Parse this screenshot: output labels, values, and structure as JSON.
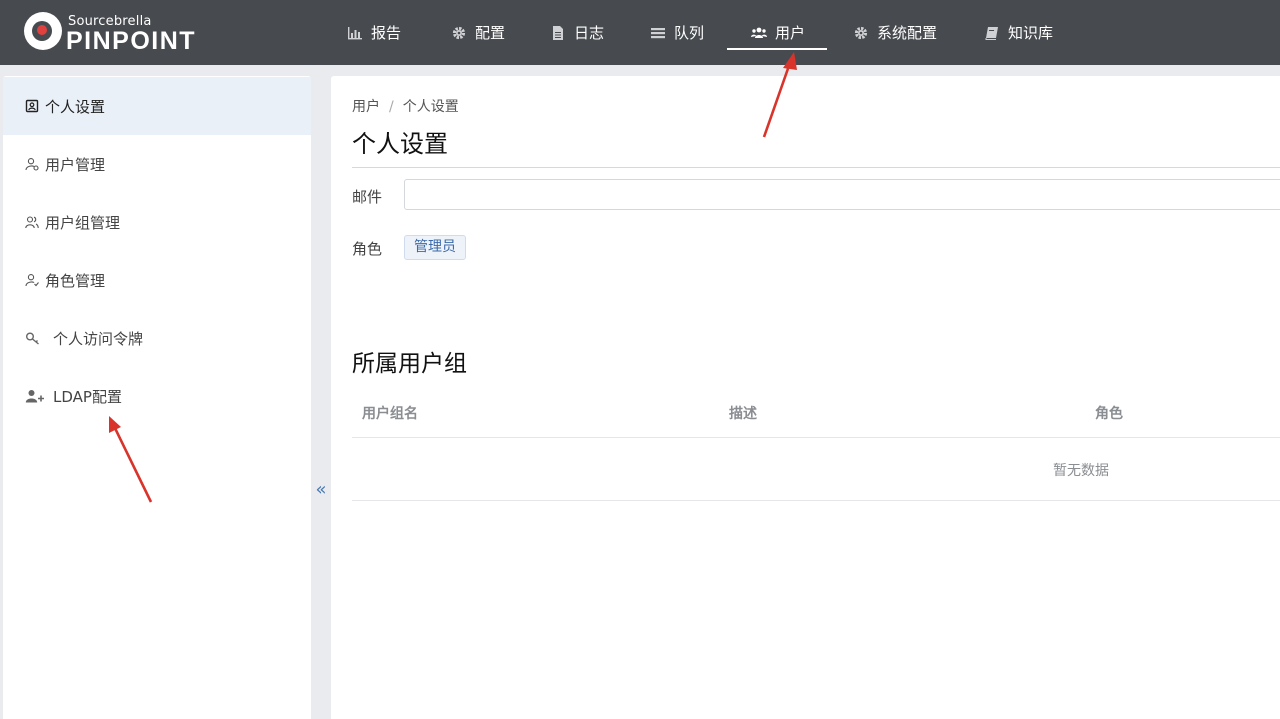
{
  "header": {
    "brand_small": "Sourcebrella",
    "brand_main": "PINPOINT",
    "nav": [
      {
        "label": "报告",
        "icon": "bar-chart-icon"
      },
      {
        "label": "配置",
        "icon": "gear-icon"
      },
      {
        "label": "日志",
        "icon": "file-icon"
      },
      {
        "label": "队列",
        "icon": "list-icon"
      },
      {
        "label": "用户",
        "icon": "users-icon",
        "active": true
      },
      {
        "label": "系统配置",
        "icon": "gear-icon"
      },
      {
        "label": "知识库",
        "icon": "book-icon"
      }
    ]
  },
  "sidebar": {
    "items": [
      {
        "label": "个人设置",
        "icon": "id-card-icon",
        "active": true
      },
      {
        "label": "用户管理",
        "icon": "user-gear-icon"
      },
      {
        "label": "用户组管理",
        "icon": "user-group-icon"
      },
      {
        "label": "角色管理",
        "icon": "user-role-icon"
      },
      {
        "label": "个人访问令牌",
        "icon": "key-icon"
      },
      {
        "label": "LDAP配置",
        "icon": "user-plus-icon"
      }
    ],
    "collapse_icon": "«"
  },
  "main": {
    "breadcrumb": [
      "用户",
      "个人设置"
    ],
    "breadcrumb_sep": "/",
    "title": "个人设置",
    "email_label": "邮件",
    "email_value": "",
    "role_label": "角色",
    "role_value": "管理员",
    "groups_title": "所属用户组",
    "table": {
      "columns": [
        "用户组名",
        "描述",
        "角色"
      ],
      "empty_text": "暂无数据"
    }
  },
  "colors": {
    "header_bg": "#474a4e",
    "accent": "#3b6aa8",
    "annotation": "#d9342b"
  }
}
